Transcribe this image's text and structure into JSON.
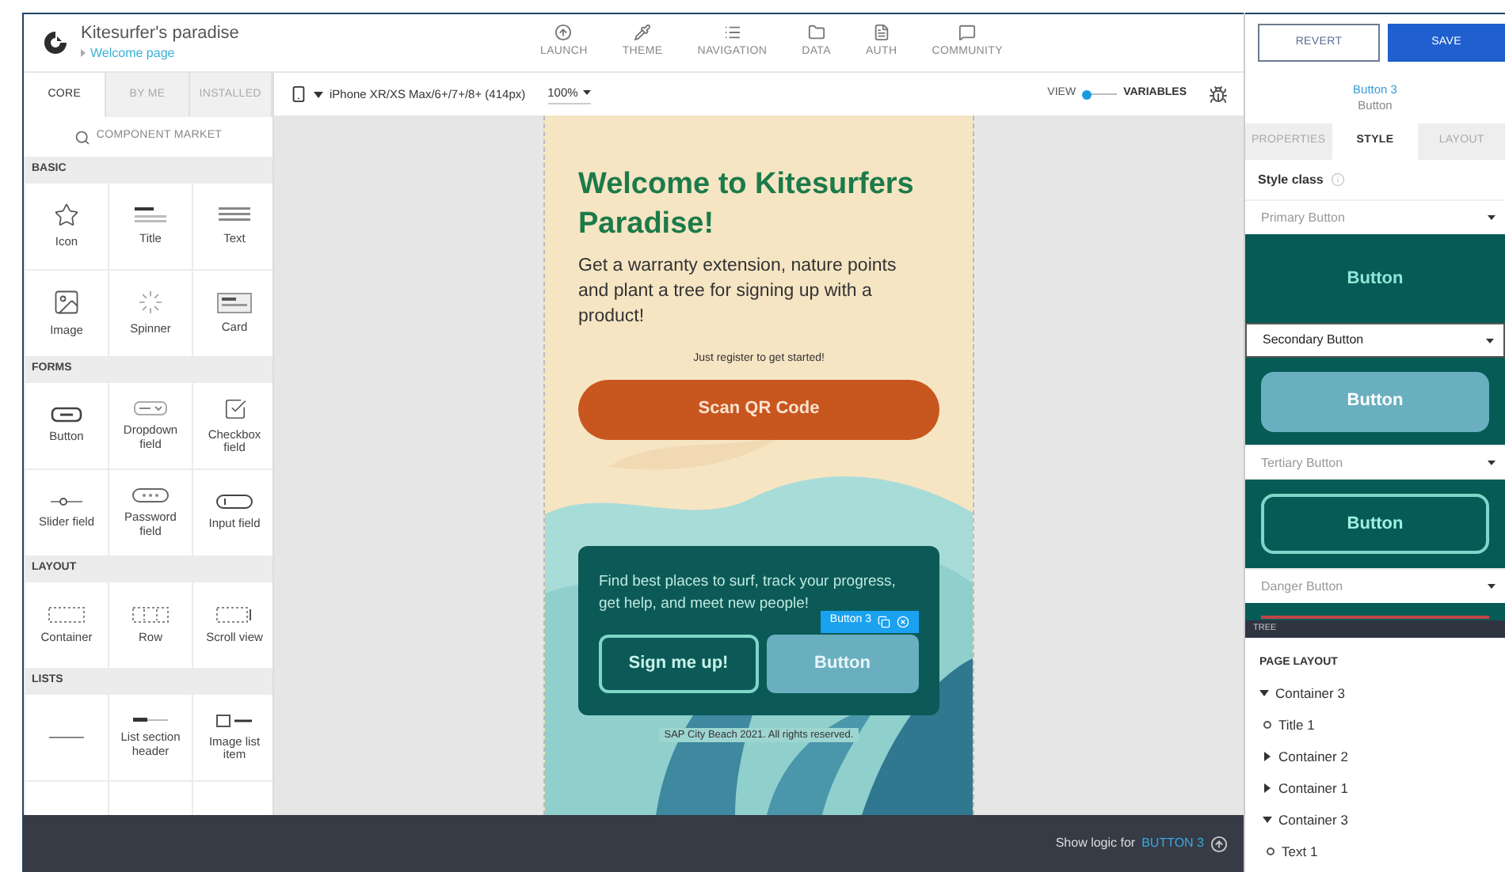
{
  "app": {
    "title": "Kitesurfer's paradise",
    "breadcrumb": "Welcome page"
  },
  "nav": [
    {
      "label": "LAUNCH",
      "kind": "launch"
    },
    {
      "label": "THEME",
      "kind": "theme"
    },
    {
      "label": "NAVIGATION",
      "kind": "navigation"
    },
    {
      "label": "DATA",
      "kind": "data"
    },
    {
      "label": "AUTH",
      "kind": "auth"
    },
    {
      "label": "COMMUNITY",
      "kind": "community"
    }
  ],
  "actions": {
    "revert": "REVERT",
    "save": "SAVE"
  },
  "palette": {
    "tabs": [
      {
        "label": "CORE",
        "selected": true
      },
      {
        "label": "BY ME",
        "selected": false
      },
      {
        "label": "INSTALLED",
        "selected": false
      }
    ],
    "market": "COMPONENT MARKET",
    "sections": [
      {
        "title": "BASIC",
        "items": [
          {
            "label": "Icon",
            "kind": "star"
          },
          {
            "label": "Title",
            "kind": "title"
          },
          {
            "label": "Text",
            "kind": "text"
          },
          {
            "label": "Image",
            "kind": "image"
          },
          {
            "label": "Spinner",
            "kind": "spinner"
          },
          {
            "label": "Card",
            "kind": "card"
          }
        ]
      },
      {
        "title": "FORMS",
        "items": [
          {
            "label": "Button",
            "kind": "button"
          },
          {
            "label": "Dropdown field",
            "kind": "dropdown"
          },
          {
            "label": "Checkbox field",
            "kind": "checkbox"
          },
          {
            "label": "Slider field",
            "kind": "slider"
          },
          {
            "label": "Password field",
            "kind": "password"
          },
          {
            "label": "Input field",
            "kind": "input"
          }
        ]
      },
      {
        "title": "LAYOUT",
        "items": [
          {
            "label": "Container",
            "kind": "container"
          },
          {
            "label": "Row",
            "kind": "row"
          },
          {
            "label": "Scroll view",
            "kind": "scroll"
          }
        ]
      },
      {
        "title": "LISTS",
        "items": [
          {
            "kind": "divider"
          },
          {
            "label": "List section header",
            "kind": "header"
          },
          {
            "label": "Image list item",
            "kind": "imagelist"
          }
        ]
      }
    ]
  },
  "toolbar": {
    "device": "iPhone XR/XS Max/6+/7+/8+ (414px)",
    "zoom": "100%",
    "view": "VIEW",
    "variables": "VARIABLES",
    "view_on": true
  },
  "screen": {
    "title": "Welcome to Kitesurfers Paradise!",
    "lead": "Get a warranty extension, nature points and plant a tree for signing up with a product!",
    "hint": "Just register to get started!",
    "scan": "Scan QR Code",
    "card_text": "Find best places to surf, track your progress, get help, and meet new people!",
    "signup": "Sign me up!",
    "button": "Button",
    "badge": "Button 3",
    "footer": "SAP City Beach 2021. All rights reserved."
  },
  "inspector": {
    "name": "Button 3",
    "type": "Button",
    "tabs": [
      {
        "label": "PROPERTIES",
        "selected": false
      },
      {
        "label": "STYLE",
        "selected": true
      },
      {
        "label": "LAYOUT",
        "selected": false
      }
    ],
    "style_class": "Style class",
    "styles": [
      {
        "label": "Primary Button",
        "kind": "primary",
        "preview": "Button",
        "selected": false
      },
      {
        "label": "Secondary Button",
        "kind": "secondary",
        "preview": "Button",
        "selected": true
      },
      {
        "label": "Tertiary Button",
        "kind": "tertiary",
        "preview": "Button",
        "selected": false
      },
      {
        "label": "Danger Button",
        "kind": "danger",
        "selected": false
      }
    ]
  },
  "tree": {
    "title": "TREE",
    "heading": "PAGE LAYOUT",
    "nodes": [
      {
        "label": "Container 3",
        "expanded": true,
        "children": [
          {
            "label": "Title 1"
          },
          {
            "label": "Container 2",
            "expanded": false
          },
          {
            "label": "Container 1",
            "expanded": false
          },
          {
            "label": "Container 3",
            "expanded": true,
            "children": [
              {
                "label": "Text 1"
              }
            ]
          }
        ]
      }
    ]
  },
  "logic": {
    "label": "Show logic for",
    "target": "BUTTON 3"
  }
}
